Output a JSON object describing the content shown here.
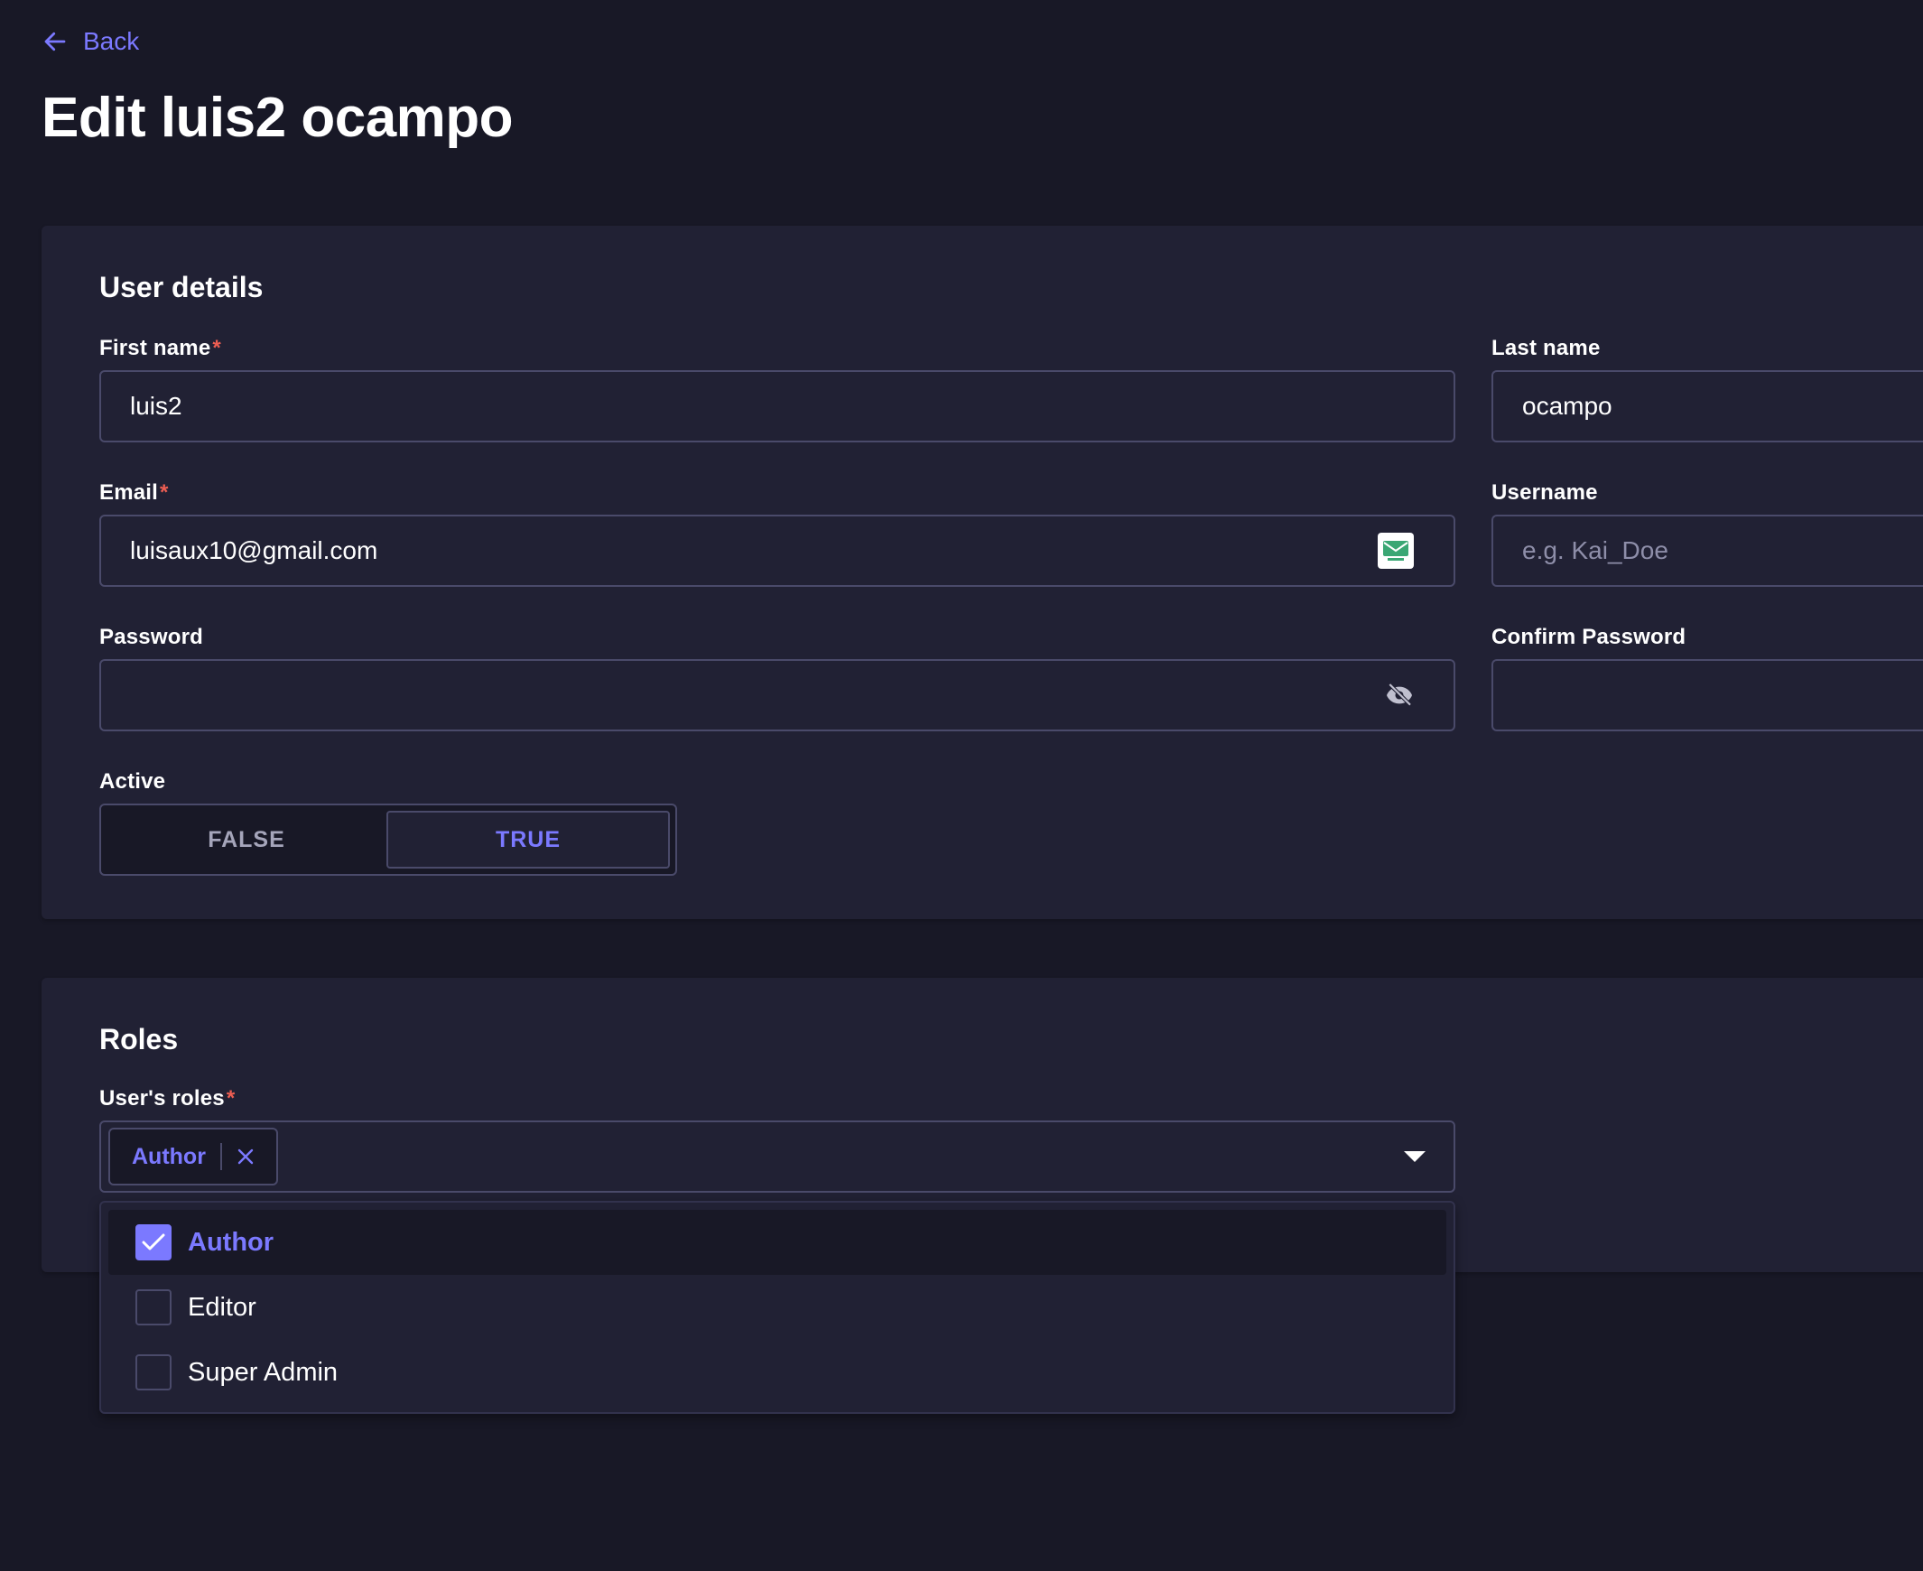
{
  "nav": {
    "back_label": "Back"
  },
  "page": {
    "title": "Edit luis2 ocampo"
  },
  "user_details": {
    "section_title": "User details",
    "first_name": {
      "label": "First name",
      "value": "luis2",
      "required": true
    },
    "last_name": {
      "label": "Last name",
      "value": "ocampo"
    },
    "email": {
      "label": "Email",
      "value": "luisaux10@gmail.com",
      "required": true
    },
    "username": {
      "label": "Username",
      "placeholder": "e.g. Kai_Doe"
    },
    "password": {
      "label": "Password",
      "value": ""
    },
    "confirm_password": {
      "label": "Confirm Password",
      "value": ""
    },
    "active": {
      "label": "Active",
      "false_label": "FALSE",
      "true_label": "TRUE",
      "selected": "TRUE"
    }
  },
  "roles": {
    "section_title": "Roles",
    "label": "User's roles",
    "required": true,
    "selected_tags": [
      "Author"
    ],
    "options": [
      {
        "label": "Author",
        "checked": true
      },
      {
        "label": "Editor",
        "checked": false
      },
      {
        "label": "Super Admin",
        "checked": false
      }
    ]
  },
  "colors": {
    "background": "#181826",
    "card": "#212134",
    "border": "#4a4a6a",
    "accent": "#7b79ff",
    "required": "#ee5e52"
  },
  "icons": {
    "back": "arrow-left-icon",
    "email_suffix": "temp-mail-icon",
    "password_suffix": "eye-slash-icon",
    "tag_remove": "close-icon",
    "select_caret": "caret-down-icon",
    "checkbox_checked": "check-icon"
  }
}
